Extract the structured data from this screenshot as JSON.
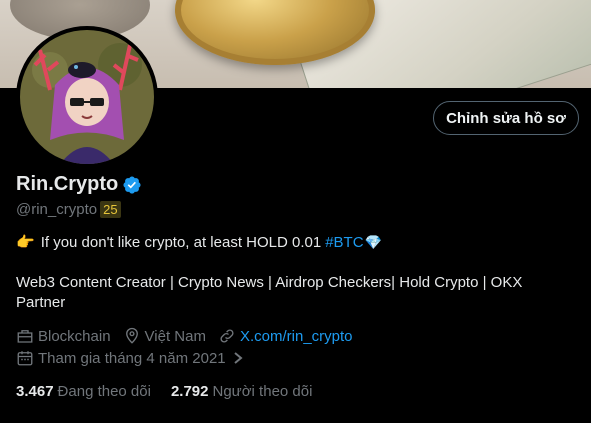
{
  "profile": {
    "display_name": "Rin.Crypto",
    "handle": "@rin_crypto",
    "badge": "25",
    "verified_icon": "verified-badge-icon",
    "bio_line1_emoji": "👉",
    "bio_line1_text": "If you don't like crypto, at least HOLD 0.01",
    "bio_hashtag": "#BTC",
    "bio_line1_end_emoji": "💎",
    "bio_line2": "Web3 Content Creator | Crypto News | Airdrop Checkers| Hold Crypto | OKX Partner",
    "category": "Blockchain",
    "location": "Việt Nam",
    "website": "X.com/rin_crypto",
    "joined": "Tham gia tháng 4 năm 2021",
    "following_count": "3.467",
    "following_label": "Đang theo dõi",
    "followers_count": "2.792",
    "followers_label": "Người theo dõi"
  },
  "actions": {
    "edit_profile": "Chỉnh sửa hồ sơ"
  },
  "colors": {
    "accent": "#1d9bf0",
    "muted": "#71767b",
    "text": "#e7e9ea",
    "background": "#000000"
  }
}
